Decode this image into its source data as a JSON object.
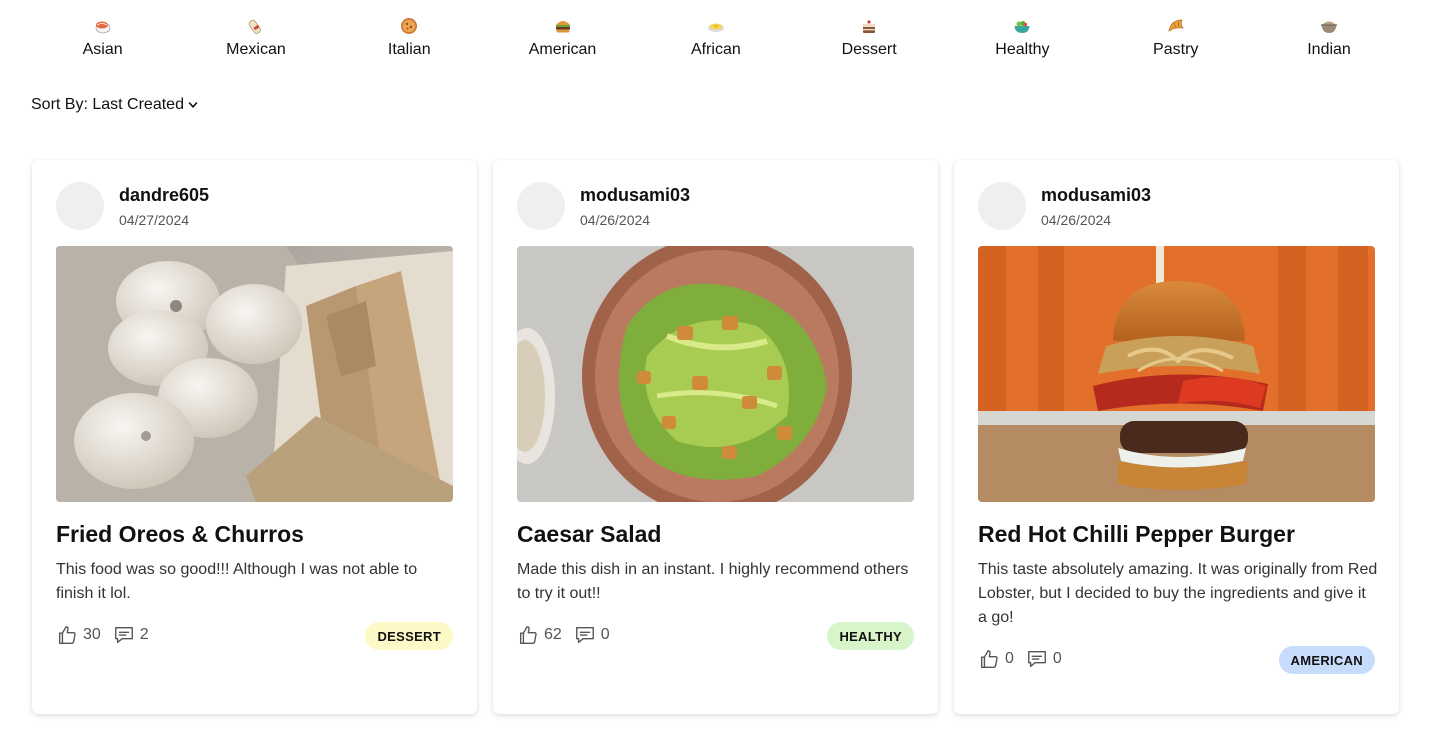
{
  "categories": [
    {
      "label": "Asian",
      "icon": "sushi-icon"
    },
    {
      "label": "Mexican",
      "icon": "burrito-icon"
    },
    {
      "label": "Italian",
      "icon": "pizza-icon"
    },
    {
      "label": "American",
      "icon": "hamburger-icon"
    },
    {
      "label": "African",
      "icon": "egg-dish-icon"
    },
    {
      "label": "Dessert",
      "icon": "cake-icon"
    },
    {
      "label": "Healthy",
      "icon": "salad-bowl-icon"
    },
    {
      "label": "Pastry",
      "icon": "croissant-icon"
    },
    {
      "label": "Indian",
      "icon": "curry-pot-icon"
    }
  ],
  "sort": {
    "label": "Sort By: Last Created",
    "icon": "chevron-down-icon"
  },
  "posts": [
    {
      "username": "dandre605",
      "date": "04/27/2024",
      "title": "Fried Oreos & Churros",
      "description": "This food was so good!!! Although I was not able to finish it lol.",
      "likes": "30",
      "comments": "2",
      "tag": "DESSERT",
      "tag_color": "#fdf9c6",
      "image": "fried-oreos-churros-photo"
    },
    {
      "username": "modusami03",
      "date": "04/26/2024",
      "title": "Caesar Salad",
      "description": "Made this dish in an instant. I highly recommend others to try it out!!",
      "likes": "62",
      "comments": "0",
      "tag": "HEALTHY",
      "tag_color": "#d8f5c9",
      "image": "caesar-salad-photo"
    },
    {
      "username": "modusami03",
      "date": "04/26/2024",
      "title": "Red Hot Chilli Pepper Burger",
      "description": "This taste absolutely amazing. It was originally from Red Lobster, but I decided to buy the ingredients and give it a go!",
      "likes": "0",
      "comments": "0",
      "tag": "AMERICAN",
      "tag_color": "#c6dcfa",
      "image": "burger-photo"
    }
  ]
}
